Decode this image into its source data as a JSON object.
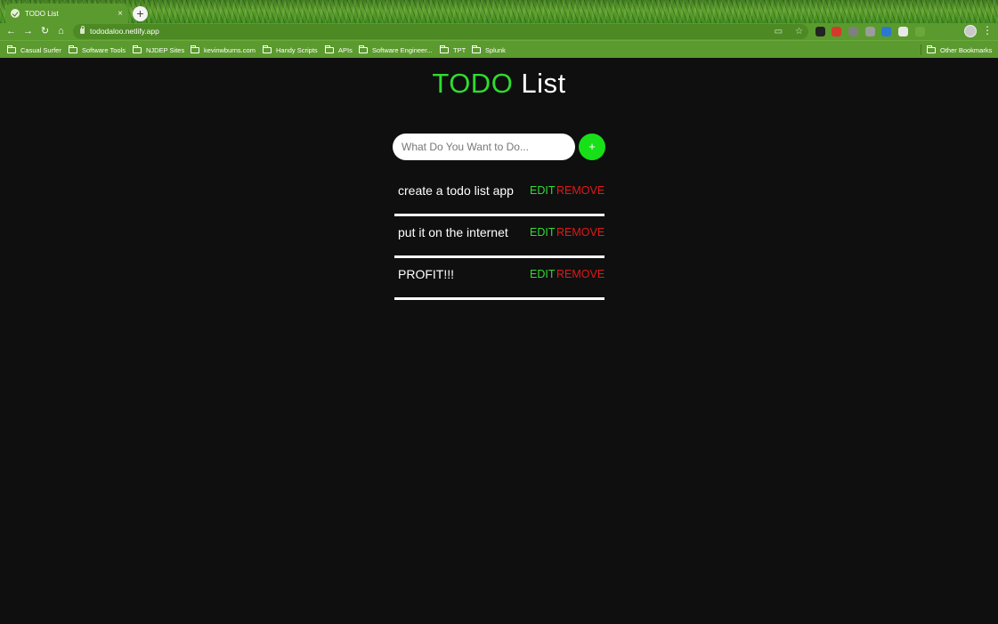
{
  "browser": {
    "tab_title": "TODO List",
    "tab_close": "×",
    "new_tab": "+",
    "url": "tododaloo.netlify.app",
    "nav": {
      "back": "←",
      "forward": "→",
      "reload": "↻",
      "home": "⌂"
    },
    "omnibox_icons": [
      "cast-icon",
      "star-icon"
    ],
    "extensions": [
      {
        "name": "ext-1-icon",
        "color": "#222222"
      },
      {
        "name": "ext-2-icon",
        "color": "#d43a2a"
      },
      {
        "name": "ext-3-icon",
        "color": "#7f7f7f"
      },
      {
        "name": "ext-4-icon",
        "color": "#9c9c9c"
      },
      {
        "name": "ext-5-icon",
        "color": "#2a78d4"
      },
      {
        "name": "ext-6-icon",
        "color": "#e8e8e8"
      },
      {
        "name": "ext-7-icon",
        "color": "#6aa83b"
      },
      {
        "name": "puzzle-icon",
        "color": "#5b9a2e"
      },
      {
        "name": "reading-list-icon",
        "color": "#5b9a2e"
      }
    ],
    "menu": "⋮"
  },
  "bookmarks": {
    "items": [
      "Casual Surfer",
      "Software Tools",
      "NJDEP Sites",
      "kevinwburns.com",
      "Handy Scripts",
      "APIs",
      "Software Engineer...",
      "TPT",
      "Splunk"
    ],
    "other": "Other Bookmarks"
  },
  "app": {
    "title_accent": "TODO",
    "title_rest": " List",
    "input_placeholder": "What Do You Want to Do...",
    "add_label": "+",
    "accent_color": "#2fdc2f",
    "danger_color": "#e01919",
    "todos": [
      {
        "text": "create a todo list app",
        "edit": "EDIT",
        "remove": "REMOVE"
      },
      {
        "text": "put it on the internet",
        "edit": "EDIT",
        "remove": "REMOVE"
      },
      {
        "text": "PROFIT!!!",
        "edit": "EDIT",
        "remove": "REMOVE"
      }
    ]
  }
}
